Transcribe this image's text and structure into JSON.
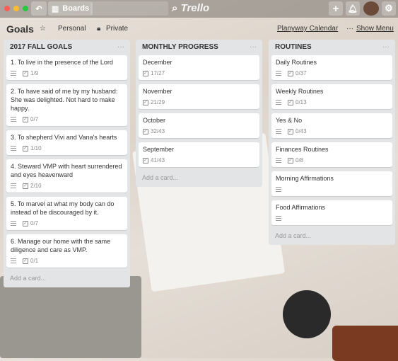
{
  "topbar": {
    "boards_label": "Boards",
    "logo": "Trello",
    "icons": [
      "back-icon",
      "boards-icon",
      "search-icon",
      "add-icon",
      "notification-bell-icon",
      "settings-gear-icon"
    ]
  },
  "board": {
    "title": "Goals",
    "team": "Personal",
    "visibility": "Private",
    "power_up": "Planyway Calendar",
    "show_menu": "Show Menu"
  },
  "lists": [
    {
      "title": "2017 FALL GOALS",
      "cards": [
        {
          "title": "1. To live in the presence of the Lord",
          "checklist": "1/9"
        },
        {
          "title": "2. To have said of me by my husband: She was delighted. Not hard to make happy.",
          "checklist": "0/7"
        },
        {
          "title": "3. To shepherd Vivi and Vana's hearts",
          "checklist": "1/10"
        },
        {
          "title": "4. Steward VMP with heart surrendered and eyes heavenward",
          "checklist": "2/10"
        },
        {
          "title": "5. To marvel at what my body can do instead of be discouraged by it.",
          "checklist": "0/7"
        },
        {
          "title": "6. Manage our home with the same diligence and care as VMP.",
          "checklist": "0/1"
        }
      ],
      "add": "Add a card..."
    },
    {
      "title": "MONTHLY PROGRESS",
      "cards": [
        {
          "title": "December",
          "checklist": "17/27"
        },
        {
          "title": "November",
          "checklist": "21/29"
        },
        {
          "title": "October",
          "checklist": "32/43"
        },
        {
          "title": "September",
          "checklist": "41/43"
        }
      ],
      "add": "Add a card..."
    },
    {
      "title": "ROUTINES",
      "cards": [
        {
          "title": "Daily Routines",
          "checklist": "0/37"
        },
        {
          "title": "Weekly Routines",
          "checklist": "0/13"
        },
        {
          "title": "Yes & No",
          "checklist": "0/43"
        },
        {
          "title": "Finances Routines",
          "checklist": "0/8"
        },
        {
          "title": "Morning Affirmations",
          "checklist": null
        },
        {
          "title": "Food Affirmations",
          "checklist": null
        }
      ],
      "add": "Add a card..."
    }
  ]
}
